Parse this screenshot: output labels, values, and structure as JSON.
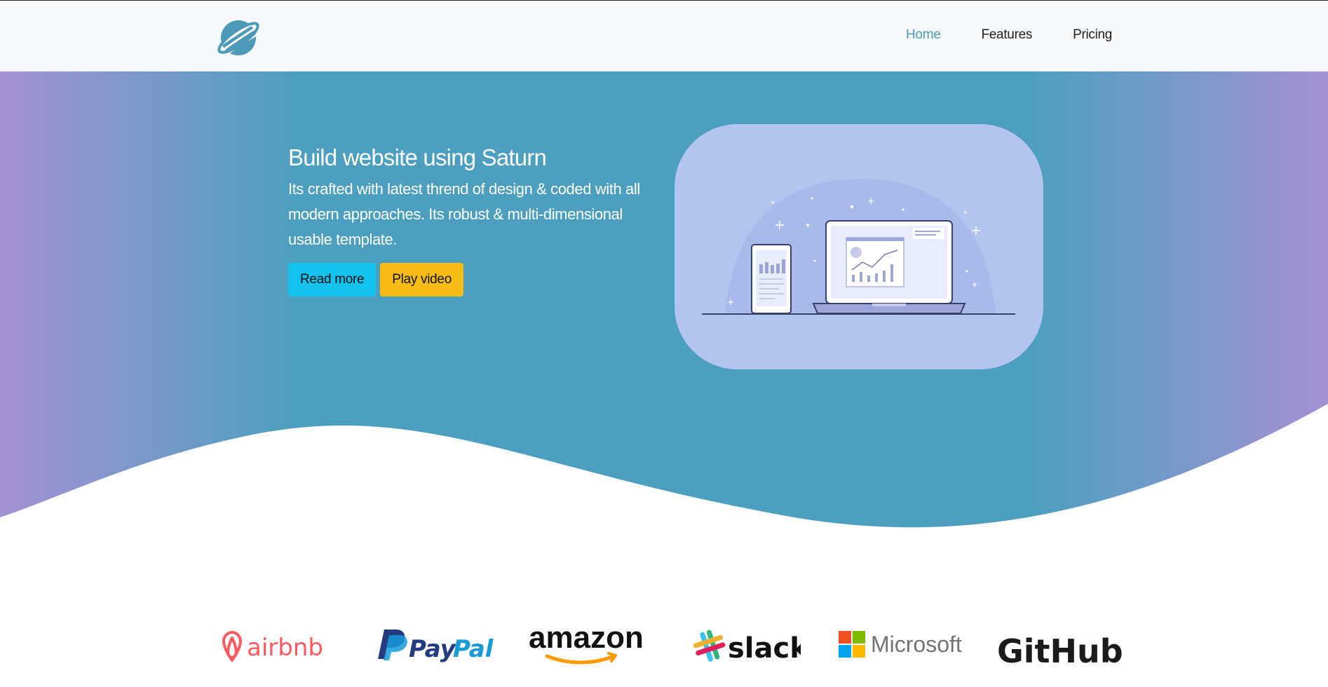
{
  "nav": {
    "links": [
      {
        "label": "Home",
        "active": true
      },
      {
        "label": "Features",
        "active": false
      },
      {
        "label": "Pricing",
        "active": false
      }
    ]
  },
  "hero": {
    "title": "Build website using Saturn",
    "description": "Its crafted with latest thrend of design & coded with all modern approaches. Its robust & multi-dimensional usable template.",
    "buttons": {
      "read_more": "Read more",
      "play_video": "Play video"
    }
  },
  "brands": {
    "airbnb": "airbnb",
    "paypal_1": "Pay",
    "paypal_2": "Pal",
    "amazon": "amazon",
    "slack": "slack",
    "microsoft": "Microsoft",
    "github": "GitHub"
  },
  "colors": {
    "hero_center": "#4d9fbf",
    "hero_edge": "#a591d4",
    "accent": "#4c9ab8",
    "read_more_bg": "#12c2ec",
    "play_video_bg": "#f7bd14",
    "illustration_bg": "#b3c4ee"
  }
}
